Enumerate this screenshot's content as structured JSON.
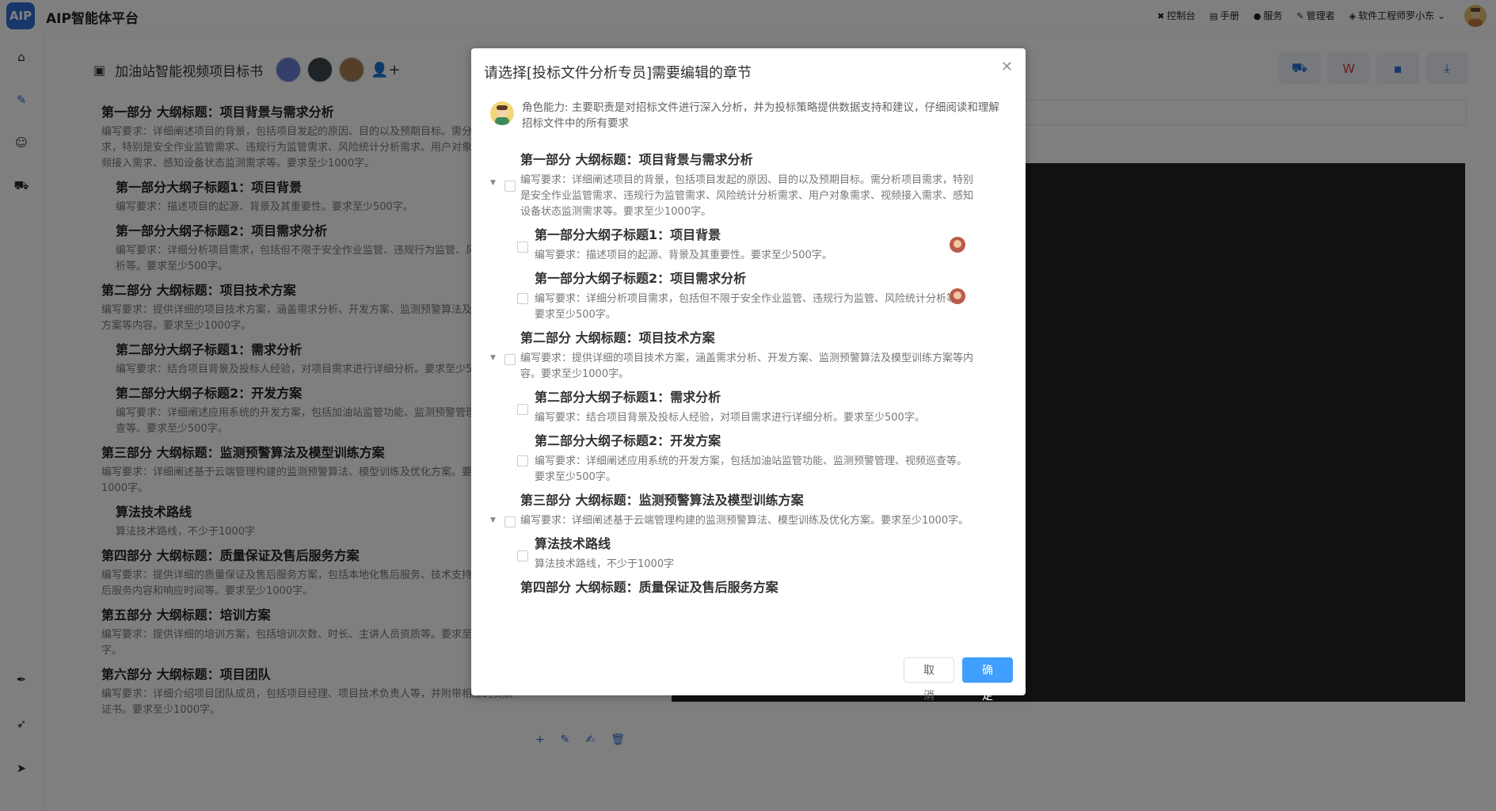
{
  "app": {
    "logo": "AIP",
    "title": "AIP智能体平台"
  },
  "topnav": [
    {
      "icon": "control-panel-icon",
      "glyph": "✖",
      "label": "控制台"
    },
    {
      "icon": "manual-icon",
      "glyph": "▤",
      "label": "手册"
    },
    {
      "icon": "service-icon",
      "glyph": "●",
      "label": "服务"
    },
    {
      "icon": "admin-icon",
      "glyph": "✎",
      "label": "管理者"
    },
    {
      "icon": "shield-icon",
      "glyph": "◈",
      "label": "软件工程师罗小东"
    }
  ],
  "document": {
    "title": "加油站智能视频项目标书"
  },
  "outline": [
    {
      "level": 1,
      "title": "第一部分 大纲标题：项目背景与需求分析",
      "req": "编写要求：详细阐述项目的背景，包括项目发起的原因、目的以及预期目标。需分析项目需求，特别是安全作业监管需求、违规行为监管需求、风险统计分析需求、用户对象需求、视频接入需求、感知设备状态监测需求等。要求至少1000字。"
    },
    {
      "level": 2,
      "title": "第一部分大纲子标题1：项目背景",
      "req": "编写要求：描述项目的起源、背景及其重要性。要求至少500字。"
    },
    {
      "level": 2,
      "title": "第一部分大纲子标题2：项目需求分析",
      "req": "编写要求：详细分析项目需求，包括但不限于安全作业监管、违规行为监管、风险统计分析等。要求至少500字。"
    },
    {
      "level": 1,
      "title": "第二部分 大纲标题：项目技术方案",
      "req": "编写要求：提供详细的项目技术方案，涵盖需求分析、开发方案、监测预警算法及模型训练方案等内容。要求至少1000字。"
    },
    {
      "level": 2,
      "title": "第二部分大纲子标题1：需求分析",
      "req": "编写要求：结合项目背景及投标人经验，对项目需求进行详细分析。要求至少500字。"
    },
    {
      "level": 2,
      "title": "第二部分大纲子标题2：开发方案",
      "req": "编写要求：详细阐述应用系统的开发方案，包括加油站监管功能、监测预警管理、视频巡查等。要求至少500字。"
    },
    {
      "level": 1,
      "title": "第三部分 大纲标题：监测预警算法及模型训练方案",
      "req": "编写要求：详细阐述基于云端管理构建的监测预警算法、模型训练及优化方案。要求至少1000字。"
    },
    {
      "level": 2,
      "title": "算法技术路线",
      "req": "算法技术路线，不少于1000字"
    },
    {
      "level": 1,
      "title": "第四部分 大纲标题：质量保证及售后服务方案",
      "req": "编写要求：提供详细的质量保证及售后服务方案，包括本地化售后服务、技术支持团队、售后服务内容和响应时间等。要求至少1000字。"
    },
    {
      "level": 1,
      "title": "第五部分 大纲标题：培训方案",
      "req": "编写要求：提供详细的培训方案，包括培训次数、时长、主讲人员资质等。要求至少1000字。"
    },
    {
      "level": 1,
      "title": "第六部分 大纲标题：项目团队",
      "req": "编写要求：详细介绍项目团队成员，包括项目经理、项目技术负责人等，并附带相应的资质证书。要求至少1000字。"
    }
  ],
  "modal": {
    "title": "请选择[投标文件分析专员]需要编辑的章节",
    "role_text": "角色能力: 主要职责是对招标文件进行深入分析，并为投标策略提供数据支持和建议，仔细阅读和理解招标文件中的所有要求",
    "cancel_label": "取 消",
    "ok_label": "确 定",
    "tree": [
      {
        "level": 1,
        "title": "第一部分 大纲标题：项目背景与需求分析",
        "req": "编写要求：详细阐述项目的背景，包括项目发起的原因、目的以及预期目标。需分析项目需求，特别是安全作业监管需求、违规行为监管需求、风险统计分析需求、用户对象需求、视频接入需求、感知设备状态监测需求等。要求至少1000字。",
        "assigned": false
      },
      {
        "level": 2,
        "title": "第一部分大纲子标题1：项目背景",
        "req": "编写要求：描述项目的起源、背景及其重要性。要求至少500字。",
        "assigned": true
      },
      {
        "level": 2,
        "title": "第一部分大纲子标题2：项目需求分析",
        "req": "编写要求：详细分析项目需求，包括但不限于安全作业监管、违规行为监管、风险统计分析等。要求至少500字。",
        "assigned": true
      },
      {
        "level": 1,
        "title": "第二部分 大纲标题：项目技术方案",
        "req": "编写要求：提供详细的项目技术方案，涵盖需求分析、开发方案、监测预警算法及模型训练方案等内容。要求至少1000字。",
        "assigned": false
      },
      {
        "level": 2,
        "title": "第二部分大纲子标题1：需求分析",
        "req": "编写要求：结合项目背景及投标人经验，对项目需求进行详细分析。要求至少500字。",
        "assigned": false
      },
      {
        "level": 2,
        "title": "第二部分大纲子标题2：开发方案",
        "req": "编写要求：详细阐述应用系统的开发方案，包括加油站监管功能、监测预警管理、视频巡查等。要求至少500字。",
        "assigned": false
      },
      {
        "level": 1,
        "title": "第三部分 大纲标题：监测预警算法及模型训练方案",
        "req": "编写要求：详细阐述基于云端管理构建的监测预警算法、模型训练及优化方案。要求至少1000字。",
        "assigned": false
      },
      {
        "level": 2,
        "title": "算法技术路线",
        "req": "算法技术路线，不少于1000字",
        "assigned": false
      },
      {
        "level": 1,
        "title": "第四部分 大纲标题：质量保证及售后服务方案",
        "req": "",
        "assigned": false
      }
    ]
  }
}
